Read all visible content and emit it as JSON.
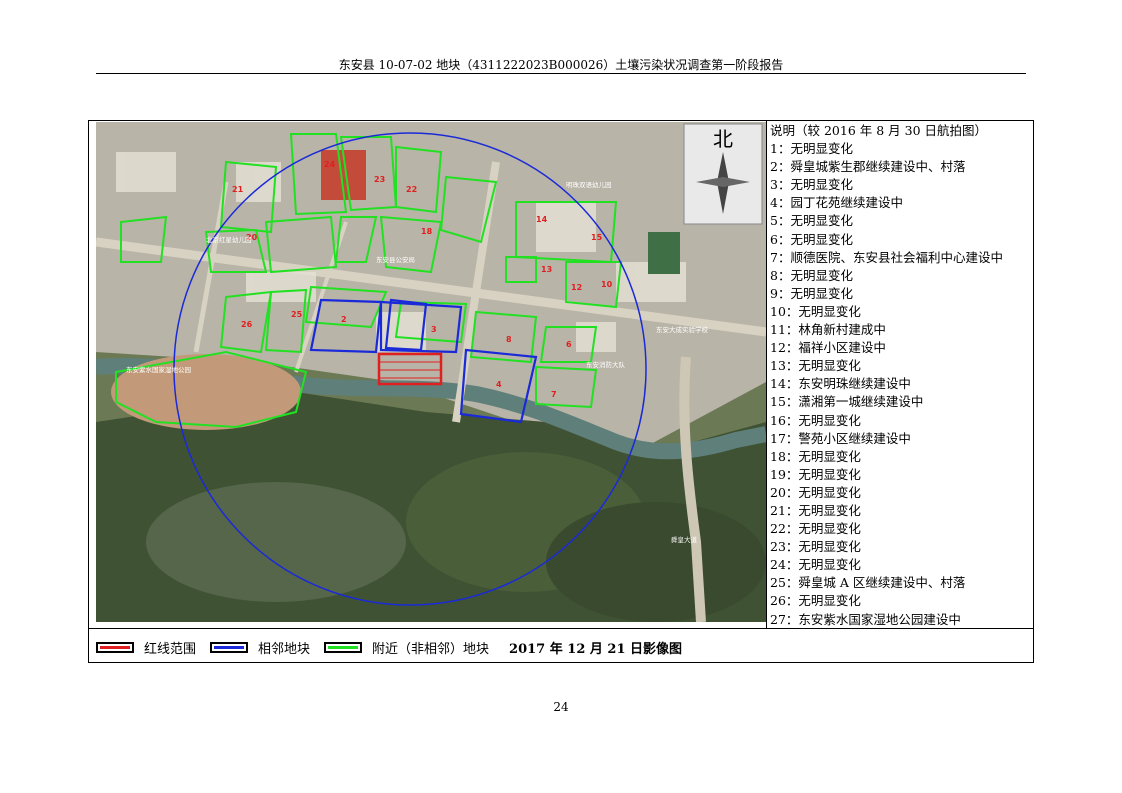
{
  "header": {
    "title": "东安县 10-07-02 地块（4311222023B000026）土壤污染状况调查第一阶段报告"
  },
  "map": {
    "north_label": "北",
    "place_labels": [
      "东安县公安局",
      "北京红星幼儿园",
      "东安镇中心校",
      "林角新村",
      "福祥小区",
      "东安明珠",
      "潇湘第一城",
      "警苑小区",
      "舜皇城",
      "东安紫水国家湿地公园",
      "东安人民医院",
      "红旗乡",
      "明珠双语幼儿园",
      "东安大成实验学校",
      "东安消防大队",
      "舜皇大道"
    ],
    "plot_numbers": [
      "1",
      "2",
      "3",
      "4",
      "5",
      "6",
      "7",
      "8",
      "9",
      "10",
      "11",
      "12",
      "13",
      "14",
      "15",
      "16",
      "17",
      "18",
      "19",
      "20",
      "21",
      "22",
      "23",
      "24",
      "25",
      "26",
      "27"
    ]
  },
  "notes": {
    "title": "说明（较 2016 年 8 月 30 日航拍图）",
    "items": [
      "1：无明显变化",
      "2：舜皇城紫生郡继续建设中、村落",
      "3：无明显变化",
      "4：园丁花苑继续建设中",
      "5：无明显变化",
      "6：无明显变化",
      "7：顺德医院、东安县社会福利中心建设中",
      "8：无明显变化",
      "9：无明显变化",
      "10：无明显变化",
      "11：林角新村建成中",
      "12：福祥小区建设中",
      "13：无明显变化",
      "14：东安明珠继续建设中",
      "15：潇湘第一城继续建设中",
      "16：无明显变化",
      "17：警苑小区继续建设中",
      "18：无明显变化",
      "19：无明显变化",
      "20：无明显变化",
      "21：无明显变化",
      "22：无明显变化",
      "23：无明显变化",
      "24：无明显变化",
      "25：舜皇城 A 区继续建设中、村落",
      "26：无明显变化",
      "27：东安紫水国家湿地公园建设中"
    ]
  },
  "legend": {
    "red_label": "红线范围",
    "blue_label": "相邻地块",
    "green_label": "附近（非相邻）地块",
    "date_label": "2017 年 12 月 21 日影像图",
    "colors": {
      "red": "#e02020",
      "blue": "#1a2ad8",
      "green": "#22e022"
    }
  },
  "footer": {
    "page_number": "24"
  }
}
